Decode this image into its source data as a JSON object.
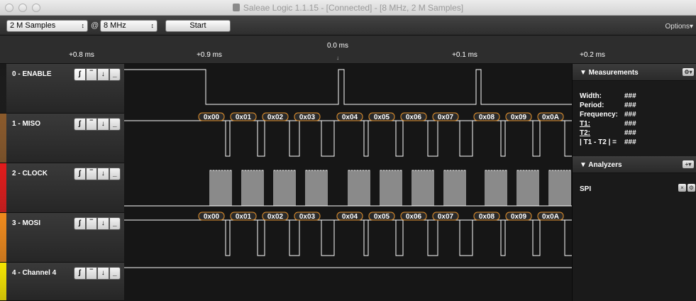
{
  "window": {
    "title": "Saleae Logic 1.1.15 - [Connected] - [8 MHz, 2 M Samples]"
  },
  "toolbar": {
    "samples": "2 M Samples",
    "at": "@",
    "rate": "8 MHz",
    "start_label": "Start",
    "options_label": "Options▾"
  },
  "ruler": {
    "center_time": "0.0 ms",
    "center_arrow": "↓",
    "ticks": [
      "+0.8 ms",
      "+0.9 ms",
      "+0.1 ms",
      "+0.2 ms"
    ]
  },
  "channels": [
    {
      "name": "0 - ENABLE",
      "color": "#1a1a1a"
    },
    {
      "name": "1 - MISO",
      "color": "#8b5a2b"
    },
    {
      "name": "2 - CLOCK",
      "color": "#e21b1b"
    },
    {
      "name": "3 - MOSI",
      "color": "#f08a1c"
    },
    {
      "name": "4 - Channel 4",
      "color": "#f5e400"
    }
  ],
  "trigger_glyphs": [
    "ʃ",
    "‾",
    "↓",
    "_"
  ],
  "miso_bytes": [
    "0x00",
    "0x01",
    "0x02",
    "0x03",
    "0x04",
    "0x05",
    "0x06",
    "0x07",
    "0x08",
    "0x09",
    "0x0A"
  ],
  "mosi_bytes": [
    "0x00",
    "0x01",
    "0x02",
    "0x03",
    "0x04",
    "0x05",
    "0x06",
    "0x07",
    "0x08",
    "0x09",
    "0x0A"
  ],
  "measurements": {
    "header": "▼ Measurements",
    "gear": "⚙▾",
    "rows": [
      {
        "label": "Width:",
        "value": "###"
      },
      {
        "label": "Period:",
        "value": "###"
      },
      {
        "label": "Frequency:",
        "value": "###"
      },
      {
        "label": "T1:",
        "value": "###"
      },
      {
        "label": "T2:",
        "value": "###"
      },
      {
        "label": "| T1 - T2 | =",
        "value": "###"
      }
    ]
  },
  "analyzers": {
    "header": "▼ Analyzers",
    "add": "+▾",
    "items": [
      {
        "name": "SPI",
        "close": "×",
        "gear": "⚙"
      }
    ]
  }
}
